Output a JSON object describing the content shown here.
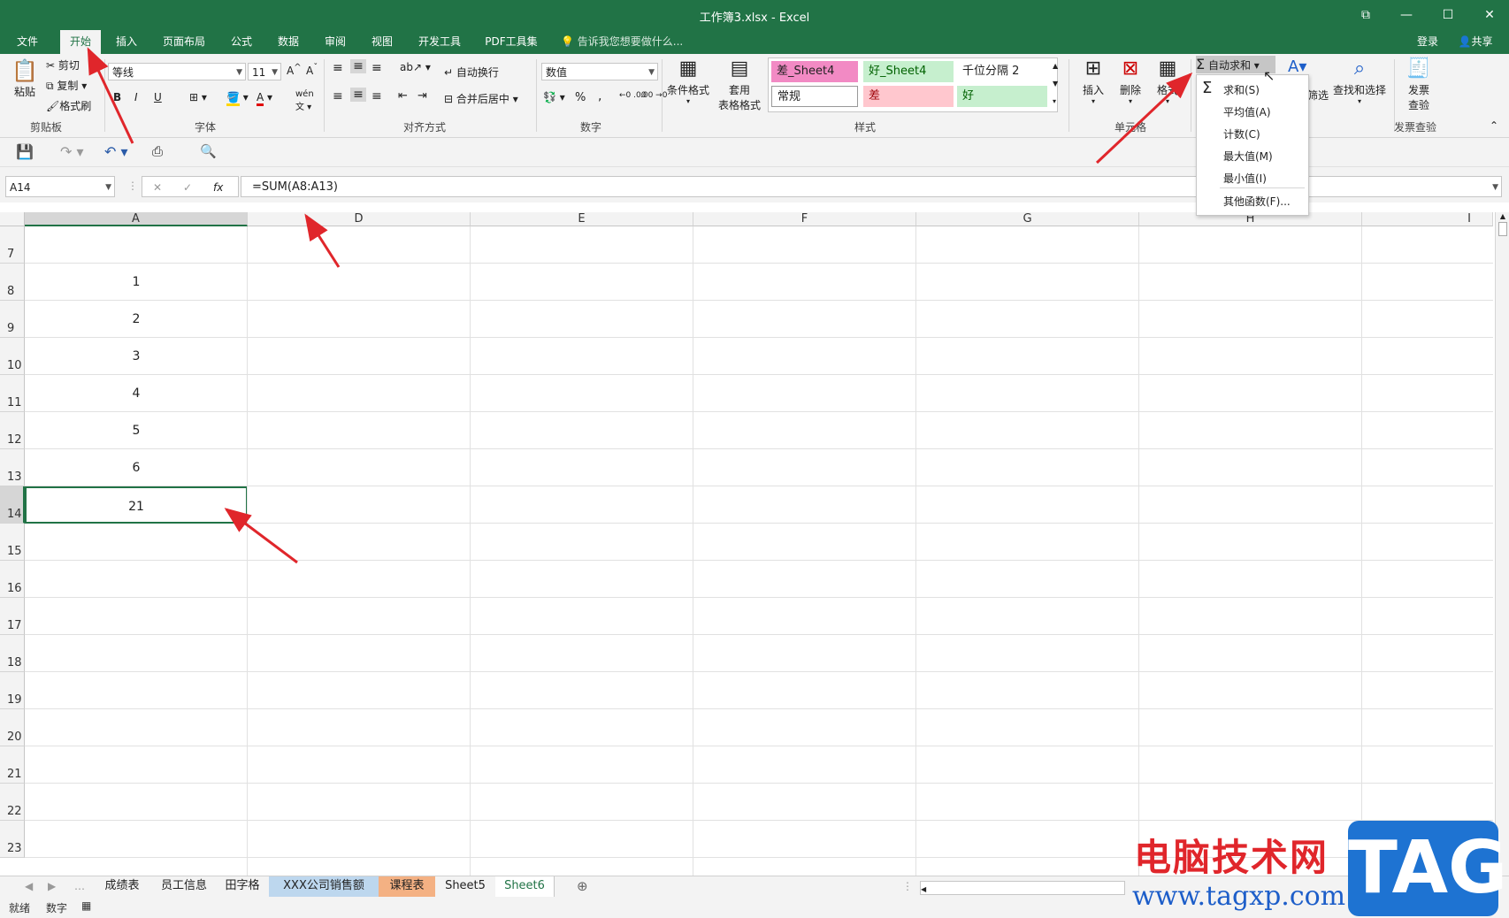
{
  "window": {
    "title": "工作簿3.xlsx - Excel",
    "controls": [
      "restore-ribbon-icon",
      "minimize-icon",
      "maximize-icon",
      "close-icon"
    ]
  },
  "ribbon_tabs": [
    "文件",
    "开始",
    "插入",
    "页面布局",
    "公式",
    "数据",
    "审阅",
    "视图",
    "开发工具",
    "PDF工具集"
  ],
  "active_tab": "开始",
  "tell_me": "告诉我您想要做什么...",
  "account": {
    "signin": "登录",
    "share": "共享"
  },
  "clipboard": {
    "paste": "粘贴",
    "cut": "剪切",
    "copy": "复制",
    "format_painter": "格式刷",
    "group": "剪贴板"
  },
  "font": {
    "name": "等线",
    "size": "11",
    "bold": "B",
    "italic": "I",
    "underline": "U",
    "phonetic": "wén",
    "group": "字体"
  },
  "alignment": {
    "wrap": "自动换行",
    "merge": "合并后居中",
    "group": "对齐方式"
  },
  "number": {
    "format": "数值",
    "percent": "%",
    "comma": ",",
    "inc_decimal": "←0 .00",
    "dec_decimal": ".00 →0",
    "group": "数字"
  },
  "styles": {
    "conditional": "条件格式",
    "table_format_1": "套用",
    "table_format_2": "表格格式",
    "cells": [
      {
        "label": "差_Sheet4",
        "color": "#f28ac4"
      },
      {
        "label": "好_Sheet4",
        "color": "#c6efce"
      },
      {
        "label": "千位分隔 2",
        "color": "#ffffff"
      },
      {
        "label": "常规",
        "color": "#ffffff"
      },
      {
        "label": "差",
        "color": "#ffc7ce"
      },
      {
        "label": "好",
        "color": "#c6efce"
      }
    ],
    "group": "样式"
  },
  "cells_group": {
    "insert": "插入",
    "delete": "删除",
    "format": "格式",
    "group": "单元格"
  },
  "editing": {
    "autosum": "自动求和",
    "filter": "筛选",
    "find": "查找和选择"
  },
  "invoice": {
    "label_1": "发票",
    "label_2": "查验",
    "group": "发票查验"
  },
  "autosum_menu": [
    "求和(S)",
    "平均值(A)",
    "计数(C)",
    "最大值(M)",
    "最小值(I)",
    "其他函数(F)..."
  ],
  "formula_bar": {
    "name_box": "A14",
    "formula": "=SUM(A8:A13)",
    "fx": "fx"
  },
  "columns": [
    "A",
    "D",
    "E",
    "F",
    "G",
    "H",
    "I"
  ],
  "rows": [
    {
      "num": "7",
      "a": ""
    },
    {
      "num": "8",
      "a": "1"
    },
    {
      "num": "9",
      "a": "2"
    },
    {
      "num": "10",
      "a": "3"
    },
    {
      "num": "11",
      "a": "4"
    },
    {
      "num": "12",
      "a": "5"
    },
    {
      "num": "13",
      "a": "6"
    },
    {
      "num": "14",
      "a": "21"
    },
    {
      "num": "15",
      "a": ""
    },
    {
      "num": "16",
      "a": ""
    },
    {
      "num": "17",
      "a": ""
    },
    {
      "num": "18",
      "a": ""
    },
    {
      "num": "19",
      "a": ""
    },
    {
      "num": "20",
      "a": ""
    },
    {
      "num": "21",
      "a": ""
    },
    {
      "num": "22",
      "a": ""
    },
    {
      "num": "23",
      "a": ""
    }
  ],
  "sheet_tabs": [
    {
      "name": "成绩表",
      "color": "#f3f3f3"
    },
    {
      "name": "员工信息",
      "color": "#f3f3f3"
    },
    {
      "name": "田字格",
      "color": "#f3f3f3"
    },
    {
      "name": "XXX公司销售额",
      "color": "#bdd7ee"
    },
    {
      "name": "课程表",
      "color": "#f4b183"
    },
    {
      "name": "Sheet5",
      "color": "#f3f3f3"
    },
    {
      "name": "Sheet6",
      "color": "#ffffff"
    }
  ],
  "active_sheet": "Sheet6",
  "status": {
    "ready": "就绪",
    "mode": "数字"
  },
  "watermark": {
    "text": "电脑技术网",
    "url": "www.tagxp.com",
    "logo": "TAG"
  }
}
